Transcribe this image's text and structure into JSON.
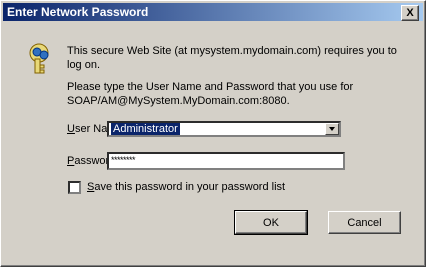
{
  "window": {
    "title": "Enter Network Password",
    "close_glyph": "X"
  },
  "icons": {
    "key": "key-icon",
    "close": "close-icon"
  },
  "message": {
    "line1": "This secure Web Site (at mysystem.mydomain.com) requires you to log on.",
    "line2": "Please type the User Name and Password that you use for SOAP/AM@MySystem.MyDomain.com:8080."
  },
  "form": {
    "username_label_mnemonic": "U",
    "username_label_rest": "ser Name",
    "username_value": "Administrator",
    "password_label_mnemonic": "P",
    "password_label_rest": "assword",
    "password_value": "********",
    "save_label_mnemonic": "S",
    "save_label_rest": "ave this password in your password list",
    "save_checked": false
  },
  "buttons": {
    "ok": "OK",
    "cancel": "Cancel"
  },
  "colors": {
    "title_bar_start": "#0a246a",
    "title_bar_end": "#a6caf0",
    "dialog_bg": "#d4d0c8"
  }
}
